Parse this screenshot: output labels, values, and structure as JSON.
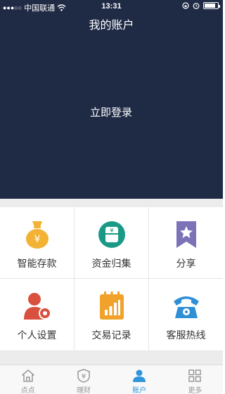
{
  "status_bar": {
    "carrier": "中国联通",
    "time": "13:31",
    "battery_level": 0.85
  },
  "header": {
    "title": "我的账户",
    "login_label": "立即登录"
  },
  "menu": [
    {
      "label": "智能存款",
      "icon": "money-bag-icon",
      "color": "#f2b233"
    },
    {
      "label": "资金归集",
      "icon": "wallet-icon",
      "color": "#1a9a86"
    },
    {
      "label": "分享",
      "icon": "star-bookmark-icon",
      "color": "#7b72b8"
    },
    {
      "label": "个人设置",
      "icon": "user-settings-icon",
      "color": "#d9503f"
    },
    {
      "label": "交易记录",
      "icon": "bar-chart-notebook-icon",
      "color": "#f0a22b"
    },
    {
      "label": "客服热线",
      "icon": "telephone-icon",
      "color": "#2f8fd6"
    }
  ],
  "tabbar": {
    "active_color": "#2f96dc",
    "inactive_color": "#999999",
    "tabs": [
      {
        "label": "点点",
        "icon": "home-icon",
        "active": false
      },
      {
        "label": "理财",
        "icon": "yen-shield-icon",
        "active": false
      },
      {
        "label": "账户",
        "icon": "person-icon",
        "active": true
      },
      {
        "label": "更多",
        "icon": "grid-icon",
        "active": false
      }
    ]
  }
}
